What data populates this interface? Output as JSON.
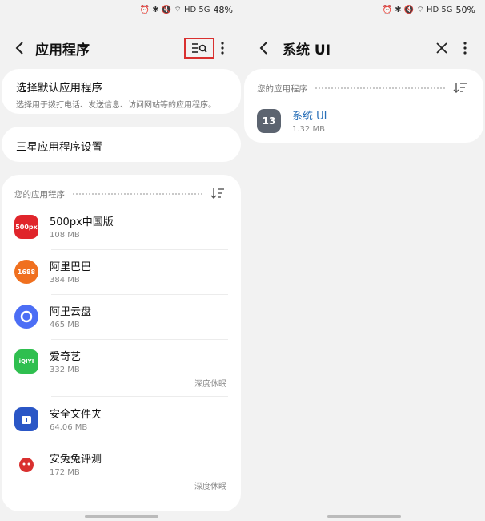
{
  "left": {
    "status": {
      "icons": "⏰ ✱ 🔇 ⌔ HD 5G",
      "battery": "48%"
    },
    "header": {
      "title": "应用程序"
    },
    "default_apps": {
      "title": "选择默认应用程序",
      "subtitle": "选择用于拨打电话、发送信息、访问网站等的应用程序。"
    },
    "samsung_settings": {
      "label": "三星应用程序设置"
    },
    "your_apps": {
      "label": "您的应用程序",
      "apps": [
        {
          "name": "500px中国版",
          "size": "108 MB",
          "tag": "",
          "icon_text": "500px",
          "color": "#e0252b"
        },
        {
          "name": "阿里巴巴",
          "size": "384 MB",
          "tag": "",
          "icon_text": "1688",
          "color": "#f0701f"
        },
        {
          "name": "阿里云盘",
          "size": "465 MB",
          "tag": "",
          "icon_text": "",
          "color": "#4c6ef5"
        },
        {
          "name": "爱奇艺",
          "size": "332 MB",
          "tag": "深度休眠",
          "icon_text": "iQIYI",
          "color": "#2fbf4f"
        },
        {
          "name": "安全文件夹",
          "size": "64.06 MB",
          "tag": "",
          "icon_text": "",
          "color": "#2a56c6"
        },
        {
          "name": "安兔兔评测",
          "size": "172 MB",
          "tag": "深度休眠",
          "icon_text": "",
          "color": "#d9302f"
        }
      ]
    }
  },
  "right": {
    "status": {
      "icons": "⏰ ✱ 🔇 ⌔ HD 5G",
      "battery": "50%"
    },
    "header": {
      "title": "系统 UI"
    },
    "your_apps": {
      "label": "您的应用程序",
      "apps": [
        {
          "name": "系统 UI",
          "size": "1.32 MB",
          "icon_text": "13",
          "color": "#5c6470"
        }
      ]
    }
  }
}
